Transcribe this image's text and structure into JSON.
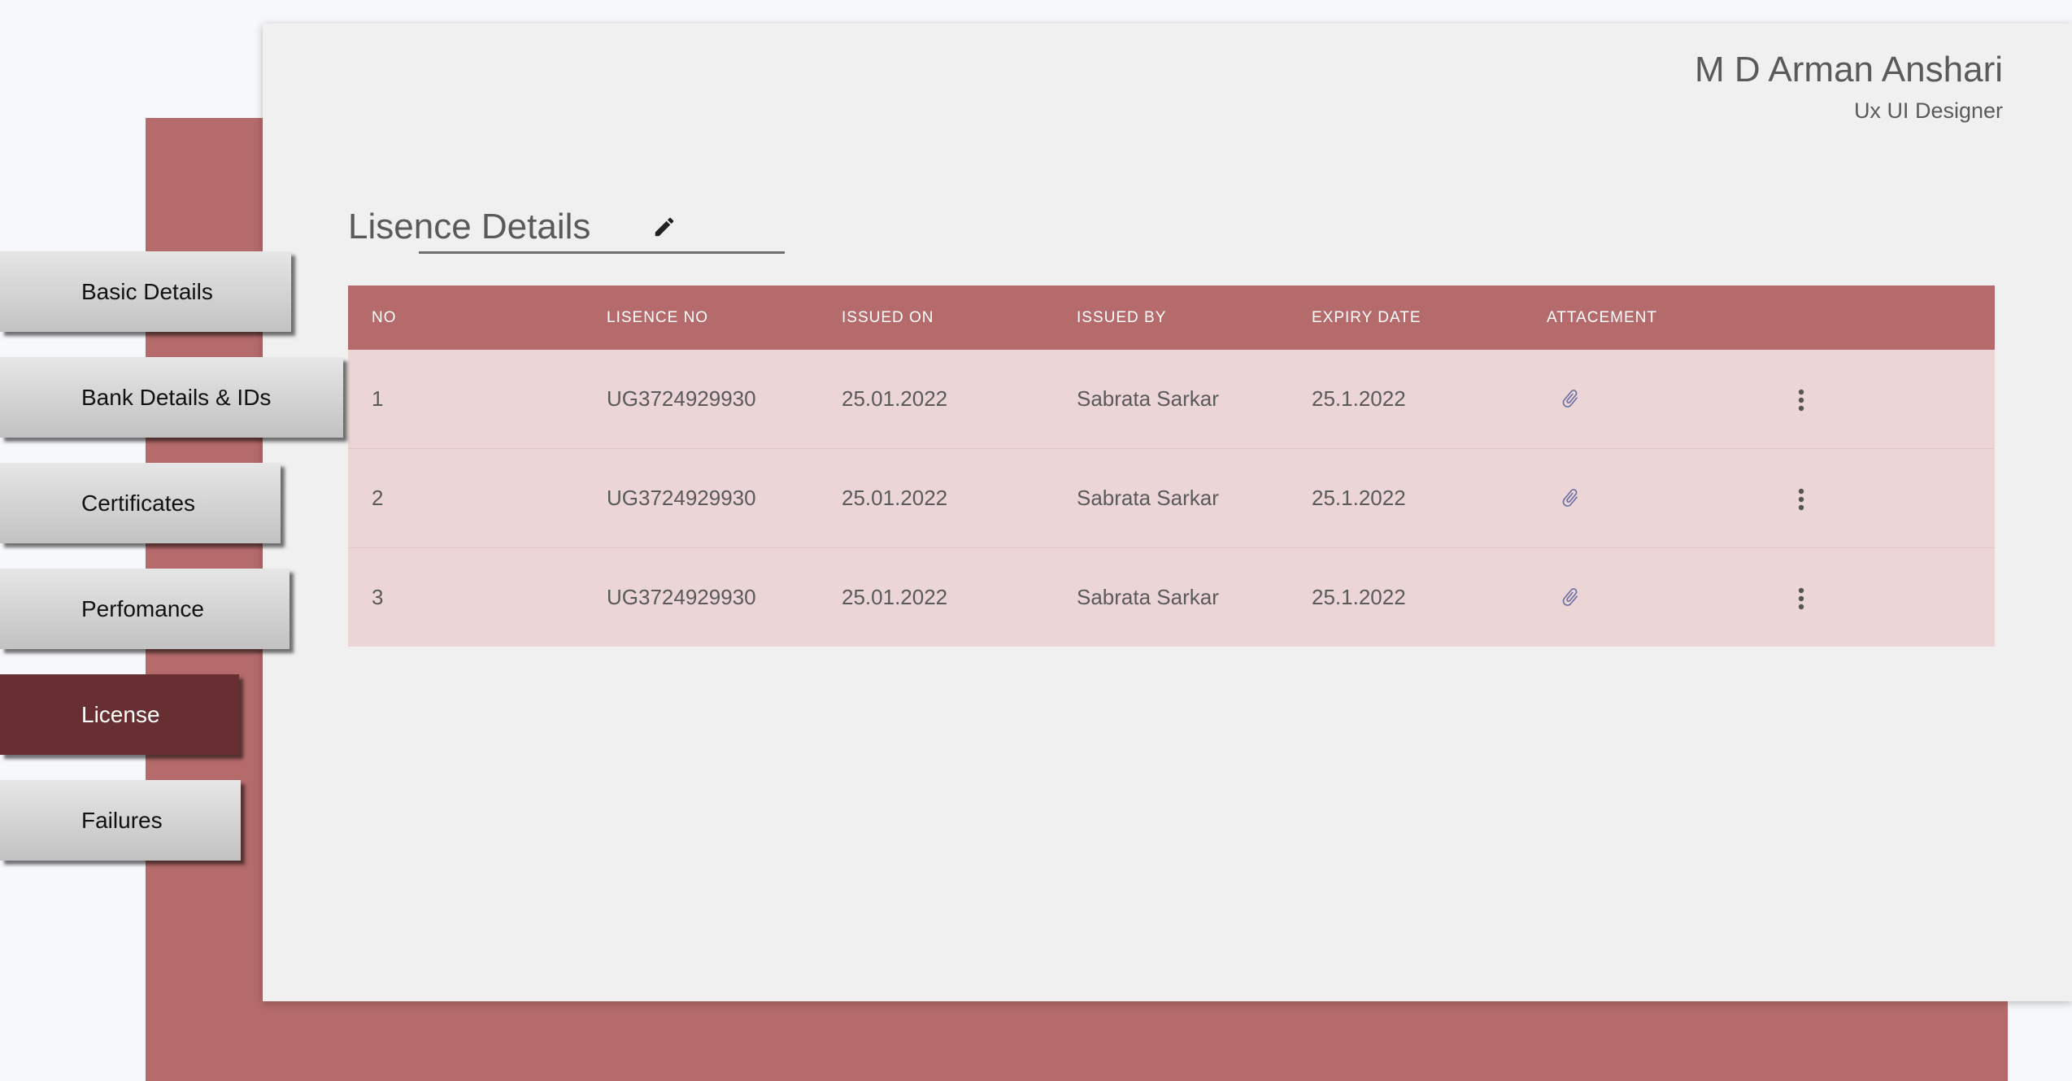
{
  "profile": {
    "name": "M D Arman Anshari",
    "role": "Ux UI Designer"
  },
  "nav": {
    "items": [
      {
        "label": "Basic Details",
        "active": false
      },
      {
        "label": "Bank Details & IDs",
        "active": false
      },
      {
        "label": "Certificates",
        "active": false
      },
      {
        "label": "Perfomance",
        "active": false
      },
      {
        "label": "License",
        "active": true
      },
      {
        "label": "Failures",
        "active": false
      }
    ]
  },
  "section": {
    "title": "Lisence Details"
  },
  "table": {
    "headers": [
      "NO",
      "LISENCE NO",
      "ISSUED ON",
      "ISSUED BY",
      "EXPIRY DATE",
      "ATTACEMENT"
    ],
    "rows": [
      {
        "no": "1",
        "licence_no": "UG3724929930",
        "issued_on": "25.01.2022",
        "issued_by": "Sabrata Sarkar",
        "expiry": "25.1.2022",
        "attachment_icon": "paperclip-icon",
        "menu_icon": "more-vertical-icon"
      },
      {
        "no": "2",
        "licence_no": "UG3724929930",
        "issued_on": "25.01.2022",
        "issued_by": "Sabrata Sarkar",
        "expiry": "25.1.2022",
        "attachment_icon": "paperclip-icon",
        "menu_icon": "more-vertical-icon"
      },
      {
        "no": "3",
        "licence_no": "UG3724929930",
        "issued_on": "25.01.2022",
        "issued_by": "Sabrata Sarkar",
        "expiry": "25.1.2022",
        "attachment_icon": "paperclip-icon",
        "menu_icon": "more-vertical-icon"
      }
    ]
  },
  "colors": {
    "accent": "#b56b6b",
    "active_nav": "#672f31",
    "row_background": "#ecd5d7",
    "card_background": "#f0f0f0",
    "page_background": "#f7f8fc"
  }
}
